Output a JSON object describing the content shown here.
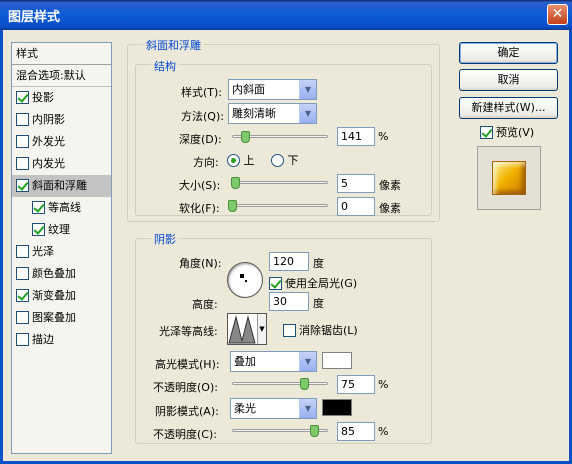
{
  "window": {
    "title": "图层样式",
    "close": "✕"
  },
  "leftlist": {
    "header": "样式",
    "blend": "混合选项:默认",
    "items": [
      {
        "label": "投影",
        "checked": true
      },
      {
        "label": "内阴影",
        "checked": false
      },
      {
        "label": "外发光",
        "checked": false
      },
      {
        "label": "内发光",
        "checked": false
      },
      {
        "label": "斜面和浮雕",
        "checked": true,
        "selected": true
      },
      {
        "label": "等高线",
        "checked": true,
        "sub": true
      },
      {
        "label": "纹理",
        "checked": true,
        "sub": true
      },
      {
        "label": "光泽",
        "checked": false
      },
      {
        "label": "颜色叠加",
        "checked": false
      },
      {
        "label": "渐变叠加",
        "checked": true
      },
      {
        "label": "图案叠加",
        "checked": false
      },
      {
        "label": "描边",
        "checked": false
      }
    ]
  },
  "bevel": {
    "section_title": "斜面和浮雕",
    "structure_title": "结构",
    "style_label": "样式(T):",
    "style_value": "内斜面",
    "technique_label": "方法(Q):",
    "technique_value": "雕刻清晰",
    "depth_label": "深度(D):",
    "depth_value": "141",
    "depth_unit": "%",
    "depth_fraction": 0.14,
    "direction_label": "方向:",
    "dir_up": "上",
    "dir_down": "下",
    "size_label": "大小(S):",
    "size_value": "5",
    "size_unit": "像素",
    "size_fraction": 0.03,
    "soften_label": "软化(F):",
    "soften_value": "0",
    "soften_unit": "像素",
    "soften_fraction": 0.0
  },
  "shading": {
    "title": "阴影",
    "angle_label": "角度(N):",
    "angle_value": "120",
    "angle_unit": "度",
    "global_light_label": "使用全局光(G)",
    "altitude_label": "高度:",
    "altitude_value": "30",
    "altitude_unit": "度",
    "gloss_label": "光泽等高线:",
    "antialias_label": "消除锯齿(L)",
    "highlight_mode_label": "高光模式(H):",
    "highlight_mode_value": "叠加",
    "highlight_color": "#ffffff",
    "opacity1_label": "不透明度(O):",
    "opacity1_value": "75",
    "opacity1_fraction": 0.75,
    "shadow_mode_label": "阴影模式(A):",
    "shadow_mode_value": "柔光",
    "shadow_color": "#000000",
    "opacity2_label": "不透明度(C):",
    "opacity2_value": "85",
    "opacity2_fraction": 0.85,
    "percent": "%"
  },
  "buttons": {
    "ok": "确定",
    "cancel": "取消",
    "new_style": "新建样式(W)...",
    "preview_label": "预览(V)"
  }
}
